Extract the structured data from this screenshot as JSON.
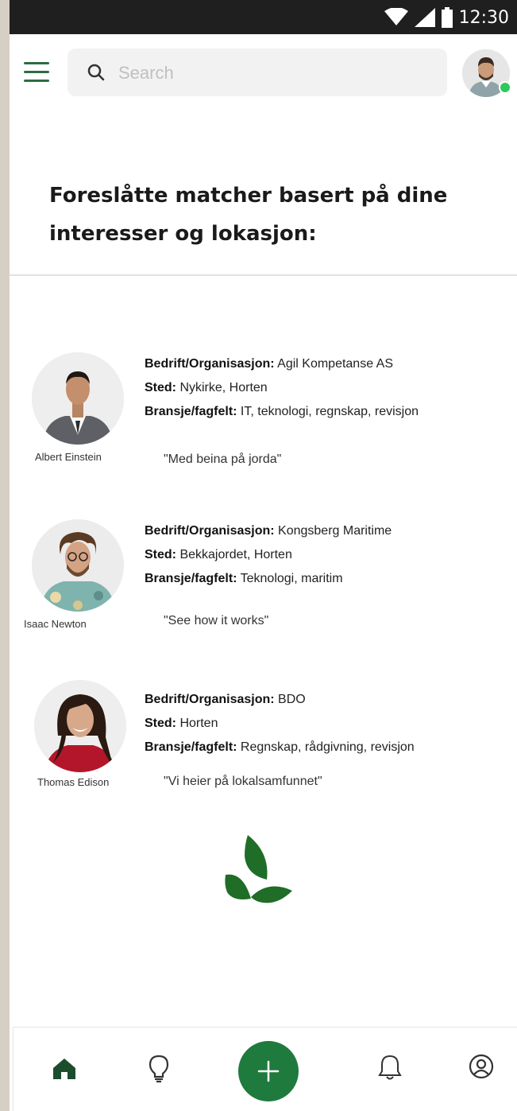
{
  "status_bar": {
    "time": "12:30"
  },
  "search": {
    "placeholder": "Search"
  },
  "headline": "Foreslåtte matcher basert på dine interesser og lokasjon:",
  "labels": {
    "org": "Bedrift/Organisasjon:",
    "place": "Sted:",
    "field": "Bransje/fagfelt:"
  },
  "matches": [
    {
      "name": "Albert Einstein",
      "org": " Agil Kompetanse AS",
      "place": " Nykirke, Horten",
      "field": " IT, teknologi, regnskap, revisjon",
      "quote": "\"Med beina på jorda\""
    },
    {
      "name": "Isaac Newton",
      "org": " Kongsberg Maritime",
      "place": " Bekkajordet, Horten",
      "field": " Teknologi, maritim",
      "quote": "\"See how it works\""
    },
    {
      "name": "Thomas Edison",
      "org": " BDO",
      "place": " Horten",
      "field": " Regnskap, rådgivning, revisjon",
      "quote": "\"Vi heier på lokalsamfunnet\""
    }
  ],
  "colors": {
    "accent": "#1f7a3d",
    "online": "#2ec95c",
    "status_bar": "#1f1f1f"
  },
  "icons": [
    "menu-icon",
    "search-icon",
    "wifi-icon",
    "signal-icon",
    "battery-icon",
    "home-icon",
    "lightbulb-icon",
    "plus-icon",
    "bell-icon",
    "profile-icon",
    "leaf-logo"
  ]
}
